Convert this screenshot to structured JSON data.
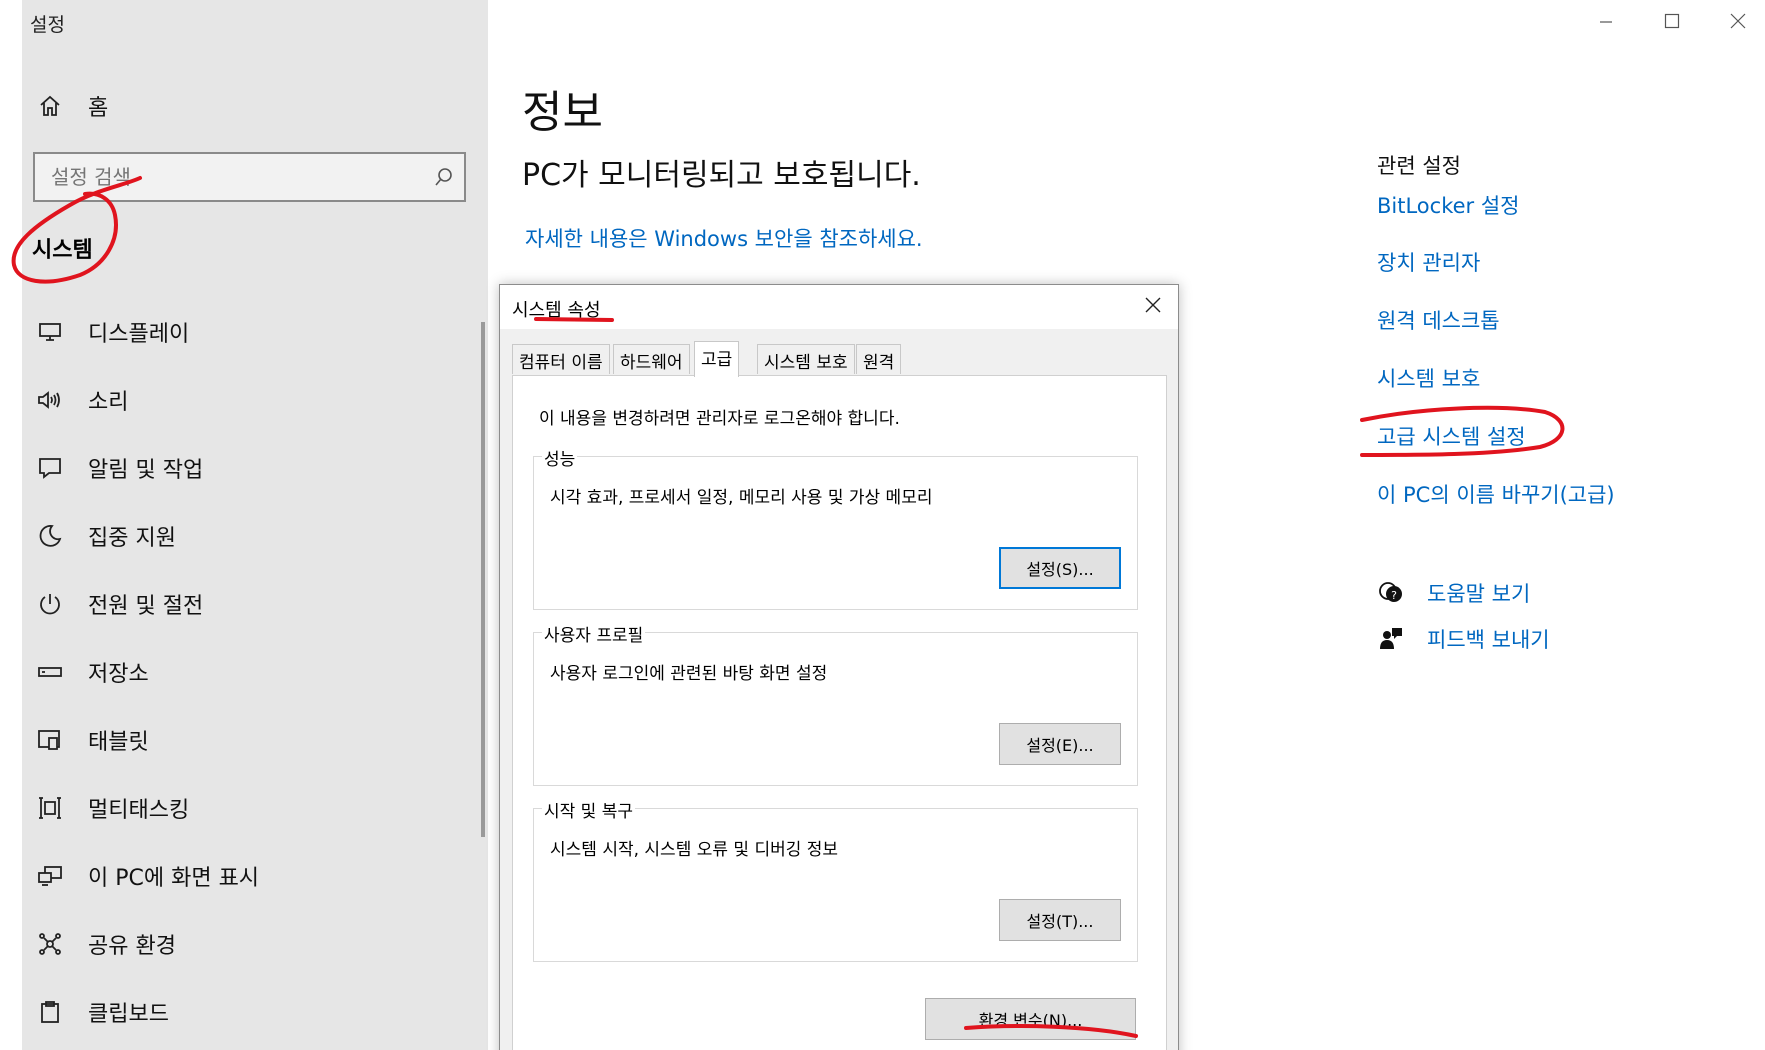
{
  "window": {
    "title": "설정",
    "controls": [
      "minimize-icon",
      "maximize-icon",
      "close-icon"
    ]
  },
  "sidebar": {
    "home_label": "홈",
    "search_placeholder": "설정 검색",
    "section_title": "시스템",
    "items": [
      {
        "label": "디스플레이",
        "icon": "display-icon"
      },
      {
        "label": "소리",
        "icon": "speaker-icon"
      },
      {
        "label": "알림 및 작업",
        "icon": "notification-icon"
      },
      {
        "label": "집중 지원",
        "icon": "moon-icon"
      },
      {
        "label": "전원 및 절전",
        "icon": "power-icon"
      },
      {
        "label": "저장소",
        "icon": "storage-icon"
      },
      {
        "label": "태블릿",
        "icon": "tablet-icon"
      },
      {
        "label": "멀티태스킹",
        "icon": "multitasking-icon"
      },
      {
        "label": "이 PC에 화면 표시",
        "icon": "project-icon"
      },
      {
        "label": "공유 환경",
        "icon": "share-icon"
      },
      {
        "label": "클립보드",
        "icon": "clipboard-icon"
      }
    ]
  },
  "main": {
    "title": "정보",
    "status": "PC가 모니터링되고 보호됩니다.",
    "security_link": "자세한 내용은 Windows 보안을 참조하세요."
  },
  "related": {
    "header": "관련 설정",
    "links": [
      "BitLocker 설정",
      "장치 관리자",
      "원격 데스크톱",
      "시스템 보호",
      "고급 시스템 설정",
      "이 PC의 이름 바꾸기(고급)"
    ],
    "help": "도움말 보기",
    "feedback": "피드백 보내기"
  },
  "dialog": {
    "title": "시스템 속성",
    "tabs": [
      "컴퓨터 이름",
      "하드웨어",
      "고급",
      "시스템 보호",
      "원격"
    ],
    "active_tab": "고급",
    "admin_note": "이 내용을 변경하려면 관리자로 로그온해야 합니다.",
    "groups": [
      {
        "legend": "성능",
        "desc": "시각 효과, 프로세서 일정, 메모리 사용 및 가상 메모리",
        "button": "설정(S)..."
      },
      {
        "legend": "사용자 프로필",
        "desc": "사용자 로그인에 관련된 바탕 화면 설정",
        "button": "설정(E)..."
      },
      {
        "legend": "시작 및 복구",
        "desc": "시스템 시작, 시스템 오류 및 디버깅 정보",
        "button": "설정(T)..."
      }
    ],
    "env_button": "환경 변수(N)..."
  },
  "colors": {
    "sidebar_bg": "#e6e6e6",
    "link": "#0067c0",
    "annotation": "#e0141e",
    "default_button_border": "#0078d7"
  }
}
